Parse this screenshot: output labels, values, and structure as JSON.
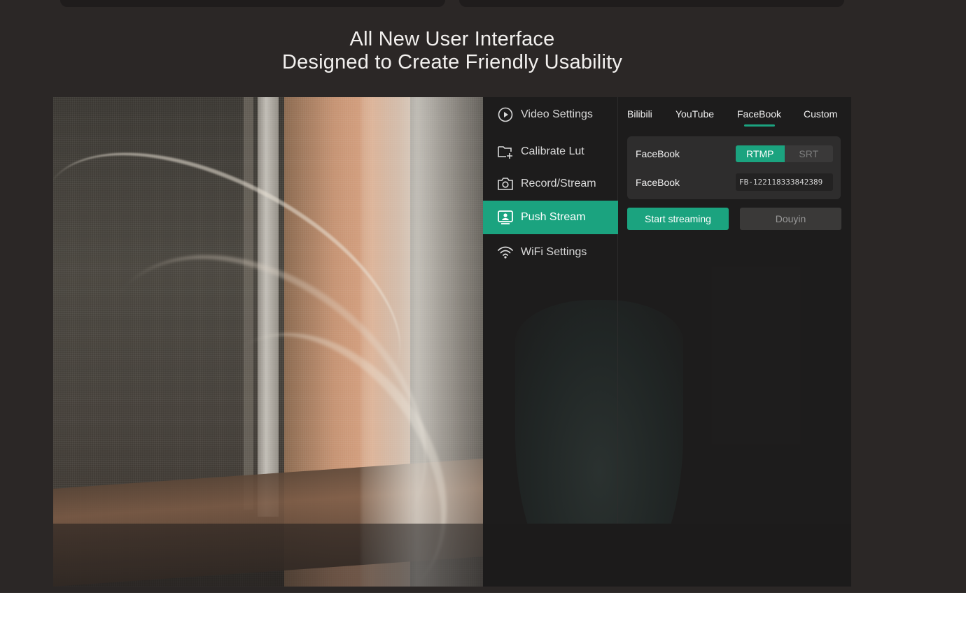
{
  "headline": {
    "line1": "All New User Interface",
    "line2": "Designed to Create Friendly Usability"
  },
  "sidebar": {
    "items": [
      {
        "label": "Video Settings",
        "icon": "play-circle-icon",
        "active": false
      },
      {
        "label": "Calibrate Lut",
        "icon": "folder-plus-icon",
        "active": false
      },
      {
        "label": "Record/Stream",
        "icon": "camera-icon",
        "active": false
      },
      {
        "label": "Push Stream",
        "icon": "push-stream-icon",
        "active": true
      },
      {
        "label": "WiFi Settings",
        "icon": "wifi-icon",
        "active": false
      }
    ]
  },
  "platform_tabs": {
    "items": [
      "Bilibili",
      "YouTube",
      "FaceBook",
      "Custom"
    ],
    "selected": "FaceBook"
  },
  "stream_config": {
    "protocol_label": "FaceBook",
    "protocol_options": [
      "RTMP",
      "SRT"
    ],
    "protocol_selected": "RTMP",
    "key_label": "FaceBook",
    "key_value": "FB-122118333842389"
  },
  "actions": {
    "start_label": "Start streaming",
    "secondary_label": "Douyin"
  },
  "colors": {
    "accent": "#1ba37f",
    "page_background": "#2b2726",
    "panel_background": "#1e1d1d"
  }
}
